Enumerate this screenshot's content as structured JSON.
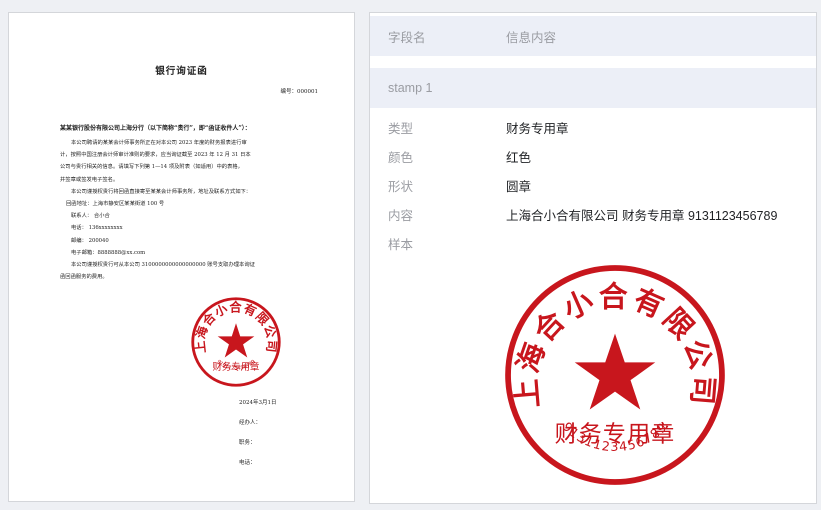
{
  "document": {
    "title": "银行询证函",
    "ref_no": "编号：000001",
    "addressee": "某某银行股份有限公司上海分行（以下简称“贵行”，即“函证收件人”）：",
    "paragraph_1": [
      "本公司聘请的某某会计师事务所正在对本公司 2023 年度的财务报表进行审",
      "计，按照中国注册会计师审计准则的要求，应当询证截至 2023 年 12 月 31 日本",
      "公司与贵行相关的信息。请填写下列第 1—14 项及附表（如适用）中的表格，",
      "并签章或签发电子签名。"
    ],
    "paragraph_2": "本公司谨授权贵行将回函直接寄至某某会计师事务所，地址及联系方式如下：",
    "contact": [
      "回函地址：上海市静安区某某街道 100 号",
      "联系人： 合小合",
      "电话： 136xxxxxxxx",
      "邮编： 200040",
      "电子邮箱：8888888@xx.com"
    ],
    "paragraph_3": [
      "本公司谨授权贵行可从本公司 3100000000000000000 账号支取办理本询证",
      "函回函服务的费用。"
    ],
    "date": "2024年3月1日",
    "signatures": [
      "经办人：",
      "职务：",
      "电话："
    ]
  },
  "panel": {
    "header": {
      "key": "字段名",
      "value": "信息内容"
    },
    "section": "stamp 1",
    "fields": [
      {
        "key": "类型",
        "value": "财务专用章"
      },
      {
        "key": "颜色",
        "value": "红色"
      },
      {
        "key": "形状",
        "value": "圆章"
      },
      {
        "key": "内容",
        "value": "上海合小合有限公司 财务专用章 9131123456789"
      },
      {
        "key": "样本",
        "value": ""
      }
    ]
  },
  "stamp": {
    "color": "#c8161d",
    "arc_text": "上海合小合有限公司",
    "center_text": "财务专用章",
    "number": "9131123456789"
  }
}
